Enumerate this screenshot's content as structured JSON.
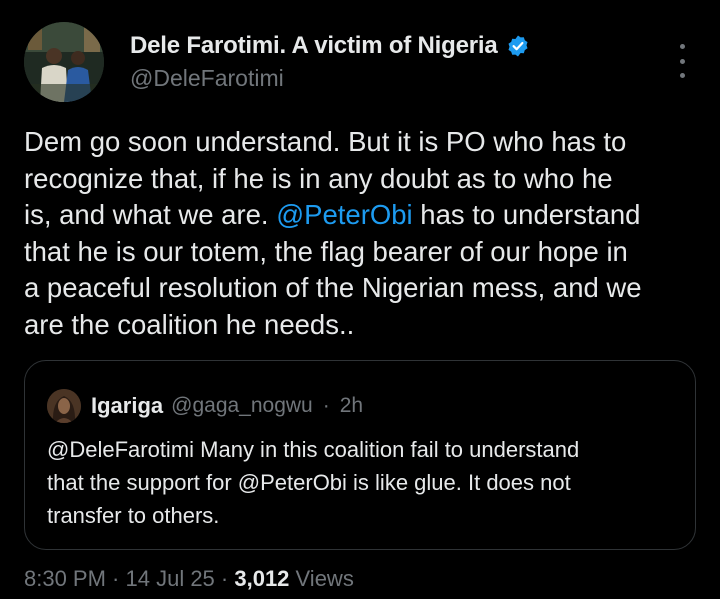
{
  "author": {
    "display_name": "Dele Farotimi. A victim of Nigeria",
    "handle": "@DeleFarotimi",
    "verified": true
  },
  "tweet": {
    "lines": [
      "Dem go soon understand. But it is PO who has to",
      "recognize that, if he is in any doubt as to who he",
      "is, and what we are.",
      "that he is our totem, the flag bearer of our hope in",
      "a peaceful resolution of the Nigerian mess, and we",
      "are the coalition he needs.."
    ],
    "line3_mention": "@PeterObi",
    "line3_rest": " has to understand"
  },
  "quoted_tweet": {
    "name": "Igariga",
    "handle": "@gaga_nogwu",
    "separator": "·",
    "time": "2h",
    "lines": [
      "@DeleFarotimi Many in this coalition fail to understand",
      "that the support for @PeterObi is like glue. It does not",
      "transfer to others."
    ]
  },
  "meta": {
    "time": "8:30 PM",
    "sep1": " · ",
    "date": "14 Jul 25",
    "sep2": " · ",
    "views_count": "3,012",
    "views_label": " Views"
  },
  "colors": {
    "background": "#000000",
    "text": "#e7e9ea",
    "secondary": "#71767b",
    "accent": "#1d9bf0",
    "border": "#2f3336"
  }
}
